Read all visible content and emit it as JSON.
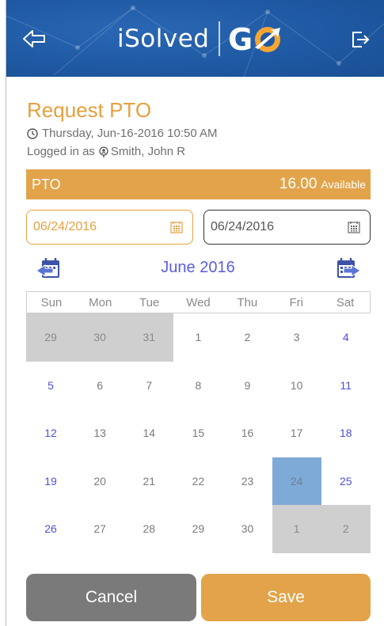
{
  "header": {
    "brand_name": "iSolved",
    "brand_suffix": "GO",
    "bg_color": "#1f59a3"
  },
  "page": {
    "title": "Request PTO",
    "datetime": "Thursday, Jun-16-2016 10:50 AM",
    "logged_in_prefix": "Logged in as",
    "user_name": "Smith, John R"
  },
  "pto": {
    "label": "PTO",
    "amount": "16.00",
    "available_label": "Available"
  },
  "date_range": {
    "from": "06/24/2016",
    "to": "06/24/2016"
  },
  "calendar": {
    "month_label": "June 2016",
    "weekdays": [
      "Sun",
      "Mon",
      "Tue",
      "Wed",
      "Thu",
      "Fri",
      "Sat"
    ],
    "selected_day": "24",
    "weeks": [
      [
        "29",
        "30",
        "31",
        "1",
        "2",
        "3",
        "4"
      ],
      [
        "5",
        "6",
        "7",
        "8",
        "9",
        "10",
        "11"
      ],
      [
        "12",
        "13",
        "14",
        "15",
        "16",
        "17",
        "18"
      ],
      [
        "19",
        "20",
        "21",
        "22",
        "23",
        "24",
        "25"
      ],
      [
        "26",
        "27",
        "28",
        "29",
        "30",
        "1",
        "2"
      ]
    ]
  },
  "buttons": {
    "cancel": "Cancel",
    "save": "Save"
  },
  "colors": {
    "accent_orange": "#e2a34a",
    "weekend_blue": "#4f4fd6",
    "selected_blue": "#7eaad7"
  }
}
